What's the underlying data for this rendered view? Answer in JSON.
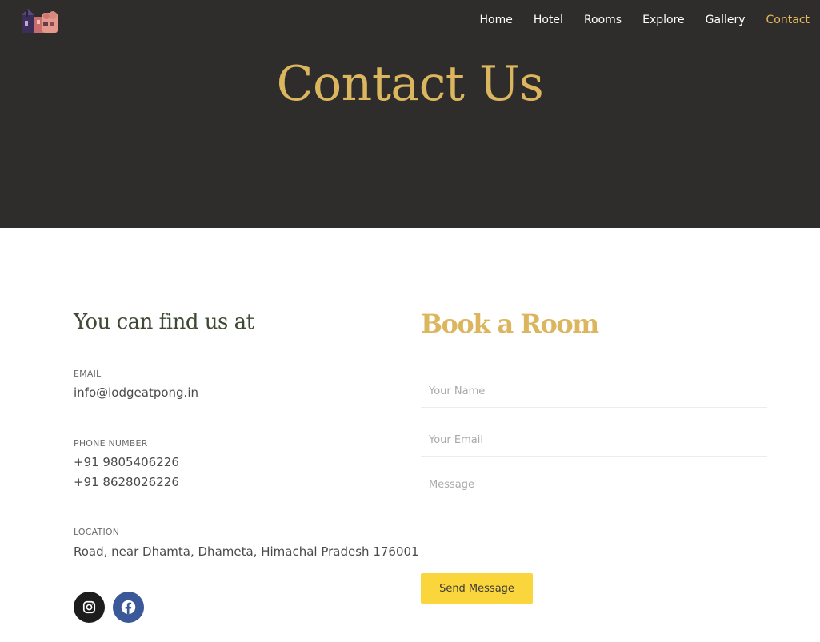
{
  "nav": {
    "items": [
      {
        "label": "Home"
      },
      {
        "label": "Hotel"
      },
      {
        "label": "Rooms"
      },
      {
        "label": "Explore"
      },
      {
        "label": "Gallery"
      },
      {
        "label": "Contact",
        "active": true
      }
    ]
  },
  "hero": {
    "title": "Contact Us"
  },
  "contact": {
    "heading": "You can find us at",
    "email_label": "EMAIL",
    "email_value": "info@lodgeatpong.in",
    "phone_label": "PHONE NUMBER",
    "phone_1": "+91 9805406226",
    "phone_2": "+91 8628026226",
    "location_label": "LOCATION",
    "location_value": "Road, near Dhamta, Dhameta, Himachal Pradesh 176001",
    "social": [
      {
        "icon": "instagram-icon"
      },
      {
        "icon": "facebook-icon"
      }
    ]
  },
  "form": {
    "heading": "Book a Room",
    "name_placeholder": "Your Name",
    "email_placeholder": "Your Email",
    "message_placeholder": "Message",
    "send_label": "Send Message"
  },
  "colors": {
    "hero_bg": "#2e2d2c",
    "accent_gold": "#dbb65e",
    "nav_active": "#e9b85a",
    "button_yellow": "#fad63c",
    "instagram_bg": "#1d1d1d",
    "facebook_bg": "#3b5998"
  }
}
